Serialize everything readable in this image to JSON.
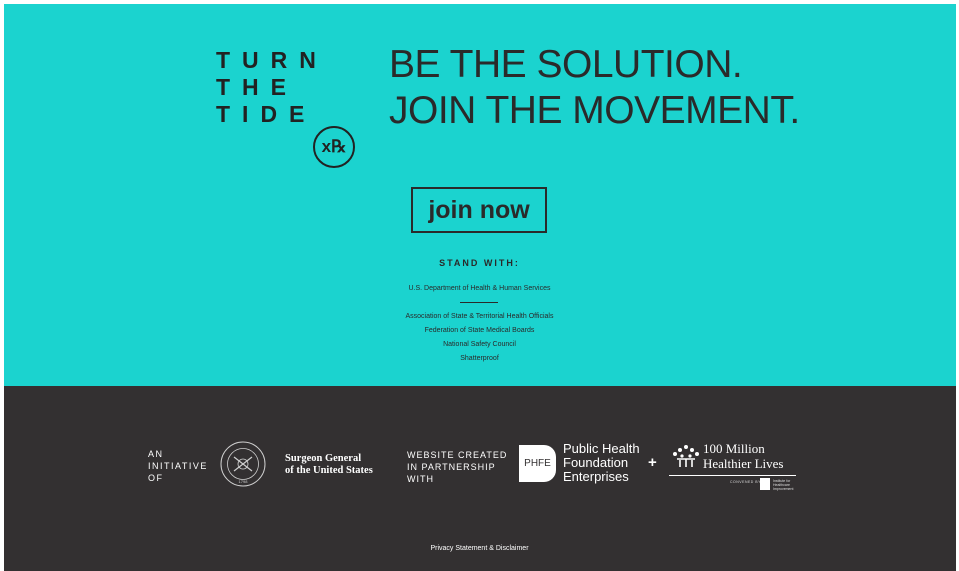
{
  "logo": {
    "lines": [
      "TURN",
      "THE",
      "TIDE"
    ],
    "badge": "x℞"
  },
  "headline": {
    "line1": "BE THE SOLUTION.",
    "line2": "JOIN THE MOVEMENT."
  },
  "join_button": "join now",
  "stand_with": {
    "title": "STAND WITH:",
    "primary": "U.S. Department of Health & Human Services",
    "partners": [
      "Association of State & Territorial Health Officials",
      "Federation of State Medical Boards",
      "National Safety Council",
      "Shatterproof"
    ]
  },
  "footer": {
    "initiative": [
      "AN",
      "INITIATIVE",
      "OF"
    ],
    "surgeon_general": [
      "Surgeon General",
      "of the United States"
    ],
    "seal_year": "1798",
    "website_created": [
      "WEBSITE CREATED",
      "IN PARTNERSHIP",
      "WITH"
    ],
    "phfe_abbrev": "PHFE",
    "phfe_name": [
      "Public Health",
      "Foundation",
      "Enterprises"
    ],
    "plus": "+",
    "hm_name": [
      "100 Million",
      "Healthier Lives"
    ],
    "hm_convened": "CONVENED BY",
    "hm_org": [
      "Institute for",
      "Healthcare",
      "Improvement"
    ],
    "privacy": "Privacy Statement",
    "amp": "&",
    "disclaimer": "Disclaimer"
  },
  "colors": {
    "hero_bg": "#1bd3cf",
    "footer_bg": "#333031",
    "text_dark": "#2a2a2a"
  }
}
